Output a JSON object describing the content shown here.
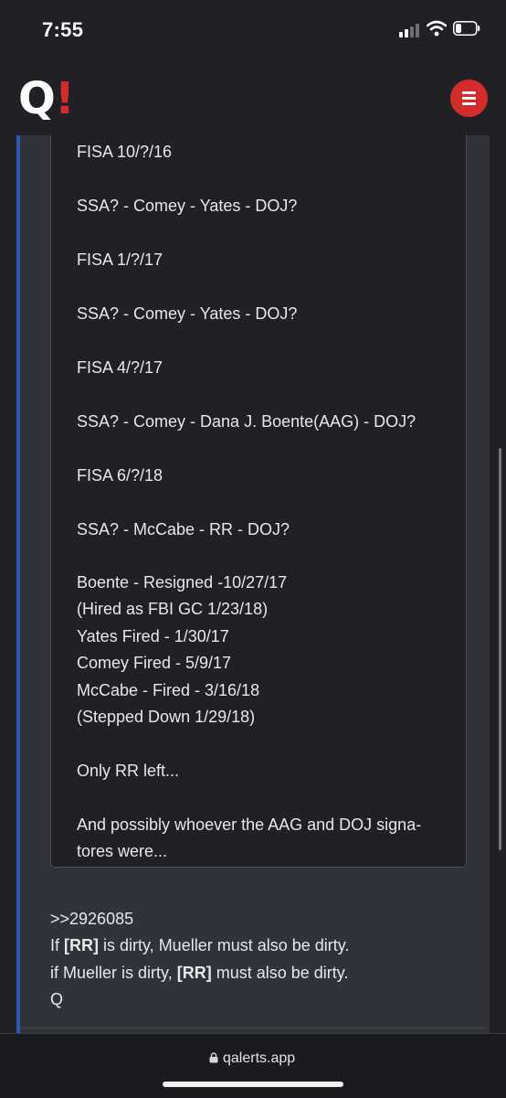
{
  "status_bar": {
    "time": "7:55"
  },
  "header": {
    "logo_q": "Q",
    "logo_mark": "!"
  },
  "quote": {
    "lines": [
      "FISA 10/?/16",
      "SSA? - Comey - Yates - DOJ?",
      "FISA 1/?/17",
      "SSA? - Comey - Yates - DOJ?",
      "FISA 4/?/17",
      "SSA? - Comey - Dana J. Boente(AAG) - DOJ?",
      "FISA 6/?/18",
      "SSA? - McCabe - RR - DOJ?",
      "Boente - Resigned -10/27/17",
      "(Hired as FBI GC 1/23/18)",
      "Yates Fired - 1/30/17",
      "Comey Fired - 5/9/17",
      "McCabe - Fired - 3/16/18",
      "(Stepped Down 1/29/18)",
      "Only RR left...",
      "And possibly whoever the AAG and DOJ signa-",
      "tores were..."
    ]
  },
  "post": {
    "reference": ">>2926085",
    "line1_before": "If ",
    "line1_bold": "[RR]",
    "line1_after": " is dirty, Mueller must also be dirty.",
    "line2_before": "if Mueller is dirty, ",
    "line2_bold": "[RR]",
    "line2_after": " must also be dirty.",
    "signature": "Q"
  },
  "browser": {
    "url": "qalerts.app"
  },
  "colors": {
    "accent_red": "#d22c2c",
    "card_border_blue": "#2e5aa8",
    "background": "#1f2126",
    "card": "#2f333a"
  },
  "icons": [
    "signal-icon",
    "wifi-icon",
    "battery-icon",
    "menu-icon",
    "lock-icon"
  ]
}
